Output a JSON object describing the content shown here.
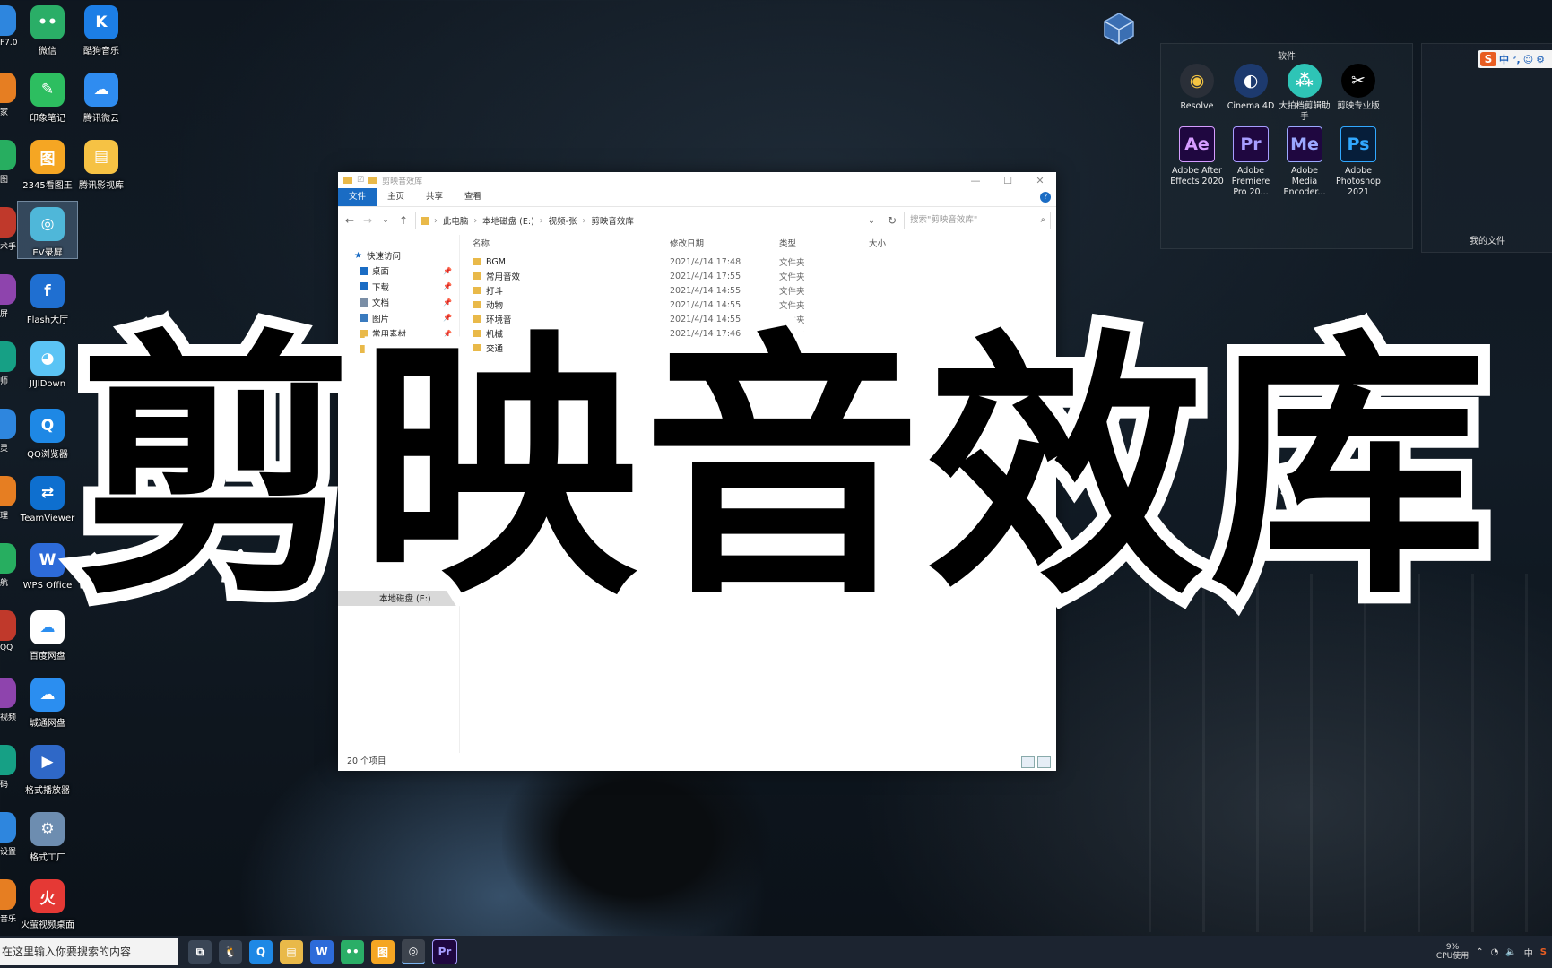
{
  "desktop": {
    "col2": [
      {
        "label": "微信",
        "icon": "wechat-icon",
        "color": "#2aae67",
        "glyph": "••"
      },
      {
        "label": "印象笔记",
        "icon": "evernote-icon",
        "color": "#2dbe60",
        "glyph": "✎"
      },
      {
        "label": "2345看图王",
        "icon": "image-viewer-icon",
        "color": "#f5a623",
        "glyph": "图"
      },
      {
        "label": "EV录屏",
        "icon": "ev-recorder-icon",
        "color": "#4fb7d9",
        "glyph": "◎",
        "selected": true
      },
      {
        "label": "Flash大厅",
        "icon": "flash-icon",
        "color": "#1f6fd1",
        "glyph": "f"
      },
      {
        "label": "JIJIDown",
        "icon": "jijidown-icon",
        "color": "#5bc4f5",
        "glyph": "◕"
      },
      {
        "label": "QQ浏览器",
        "icon": "qq-browser-icon",
        "color": "#1e88e5",
        "glyph": "Q"
      },
      {
        "label": "TeamViewer",
        "icon": "teamviewer-icon",
        "color": "#0e6fcf",
        "glyph": "⇄"
      },
      {
        "label": "WPS Office",
        "icon": "wps-icon",
        "color": "#2d6bd9",
        "glyph": "W"
      },
      {
        "label": "百度网盘",
        "icon": "baidu-netdisk-icon",
        "color": "#ffffff",
        "glyph": "☁"
      },
      {
        "label": "城通网盘",
        "icon": "ctfile-icon",
        "color": "#2b8ef0",
        "glyph": "☁"
      },
      {
        "label": "格式播放器",
        "icon": "format-player-icon",
        "color": "#2f68c7",
        "glyph": "▶"
      },
      {
        "label": "格式工厂",
        "icon": "format-factory-icon",
        "color": "#6d8db0",
        "glyph": "⚙"
      },
      {
        "label": "火萤视频桌面",
        "icon": "huoying-icon",
        "color": "#e53935",
        "glyph": "火"
      }
    ],
    "col3": [
      {
        "label": "酷狗音乐",
        "icon": "kugou-icon",
        "color": "#1c7ee6",
        "glyph": "K"
      },
      {
        "label": "腾讯微云",
        "icon": "weiyun-icon",
        "color": "#2f8cf0",
        "glyph": "☁"
      },
      {
        "label": "腾讯影视库",
        "icon": "tencent-video-lib-icon",
        "color": "#f6c244",
        "glyph": "▤"
      }
    ],
    "partials": [
      "F7.0",
      "家",
      "图",
      "术手",
      "屏",
      "师",
      "灵",
      "理",
      "航",
      "QQ",
      "视频",
      "码",
      "设置",
      "音乐"
    ]
  },
  "fence": {
    "title": "软件",
    "apps": [
      {
        "label": "Resolve",
        "icon": "davinci-resolve-icon",
        "bg": "#2a2f38",
        "fg": "#f5c542",
        "glyph": "◉"
      },
      {
        "label": "Cinema 4D",
        "icon": "cinema4d-icon",
        "bg": "#1d3a6e",
        "fg": "#ffffff",
        "glyph": "◐"
      },
      {
        "label": "大拍档剪辑助手",
        "icon": "dapaidang-icon",
        "bg": "#2ec4b6",
        "fg": "#ffffff",
        "glyph": "⁂"
      },
      {
        "label": "剪映专业版",
        "icon": "jianying-icon",
        "bg": "#000000",
        "fg": "#ffffff",
        "glyph": "✂"
      },
      {
        "label": "Adobe After Effects 2020",
        "icon": "after-effects-icon",
        "bg": "#1f0740",
        "fg": "#d59cff",
        "glyph": "Ae"
      },
      {
        "label": "Adobe Premiere Pro 20...",
        "icon": "premiere-pro-icon",
        "bg": "#1f0740",
        "fg": "#a79dff",
        "glyph": "Pr"
      },
      {
        "label": "Adobe Media Encoder...",
        "icon": "media-encoder-icon",
        "bg": "#1f0740",
        "fg": "#9ba8ff",
        "glyph": "Me"
      },
      {
        "label": "Adobe Photoshop 2021",
        "icon": "photoshop-icon",
        "bg": "#061e3a",
        "fg": "#31a8ff",
        "glyph": "Ps"
      }
    ]
  },
  "fence2": {
    "title": "我的文件"
  },
  "ime": {
    "logo": "S",
    "mode": "中"
  },
  "explorer": {
    "title": "剪映音效库",
    "tabs": {
      "file": "文件",
      "home": "主页",
      "share": "共享",
      "view": "查看"
    },
    "breadcrumb": [
      "此电脑",
      "本地磁盘 (E:)",
      "视频-张",
      "剪映音效库"
    ],
    "search_placeholder": "搜索\"剪映音效库\"",
    "nav": [
      {
        "label": "快速访问",
        "icon": "star-icon",
        "color": "#1a6cc4",
        "lvl": 1
      },
      {
        "label": "桌面",
        "icon": "desktop-icon",
        "color": "#1a6cc4",
        "lvl": 2,
        "pin": true
      },
      {
        "label": "下载",
        "icon": "download-icon",
        "color": "#1a6cc4",
        "lvl": 2,
        "pin": true
      },
      {
        "label": "文档",
        "icon": "document-icon",
        "color": "#7a8ea6",
        "lvl": 2,
        "pin": true
      },
      {
        "label": "图片",
        "icon": "picture-icon",
        "color": "#3a7bbf",
        "lvl": 2,
        "pin": true
      },
      {
        "label": "常用素材",
        "icon": "folder-icon",
        "color": "#e9b949",
        "lvl": 2,
        "pin": true
      },
      {
        "label": "常用音效",
        "icon": "folder-icon",
        "color": "#e9b949",
        "lvl": 2,
        "pin": false
      }
    ],
    "nav_selected": "本地磁盘 (E:)",
    "columns": {
      "name": "名称",
      "date": "修改日期",
      "type": "类型",
      "size": "大小"
    },
    "rows": [
      {
        "name": "BGM",
        "date": "2021/4/14 17:48",
        "type": "文件夹"
      },
      {
        "name": "常用音效",
        "date": "2021/4/14 17:55",
        "type": "文件夹"
      },
      {
        "name": "打斗",
        "date": "2021/4/14 14:55",
        "type": "文件夹"
      },
      {
        "name": "动物",
        "date": "2021/4/14 14:55",
        "type": "文件夹"
      },
      {
        "name": "环境音",
        "date": "2021/4/14 14:55",
        "type": "文件夹"
      },
      {
        "name": "机械",
        "date": "2021/4/14 17:46",
        "type": "文件夹"
      },
      {
        "name": "交通",
        "date": "2021/4/14 14:4",
        "type": ""
      }
    ],
    "status": "20 个项目"
  },
  "overlay_title": "剪映音效库",
  "taskbar": {
    "search_text": "在这里输入你要搜索的内容",
    "apps": [
      {
        "icon": "task-view-icon",
        "glyph": "⧉",
        "color": "#3a4656"
      },
      {
        "icon": "qq-icon",
        "glyph": "🐧",
        "color": "#3a4656"
      },
      {
        "icon": "qq-browser-icon",
        "glyph": "Q",
        "color": "#1e88e5"
      },
      {
        "icon": "file-explorer-icon",
        "glyph": "▤",
        "color": "#e9b949"
      },
      {
        "icon": "wps-icon",
        "glyph": "W",
        "color": "#2d6bd9"
      },
      {
        "icon": "wechat-icon",
        "glyph": "••",
        "color": "#2aae67"
      },
      {
        "icon": "image-viewer-icon",
        "glyph": "图",
        "color": "#f5a623"
      },
      {
        "icon": "ev-recorder-icon",
        "glyph": "◎",
        "color": "#4fb7d9",
        "active": true
      },
      {
        "icon": "premiere-pro-icon",
        "glyph": "Pr",
        "color": "#1f0740"
      }
    ],
    "cpu_value": "9%",
    "cpu_label": "CPU使用",
    "tray_lang": "中"
  }
}
